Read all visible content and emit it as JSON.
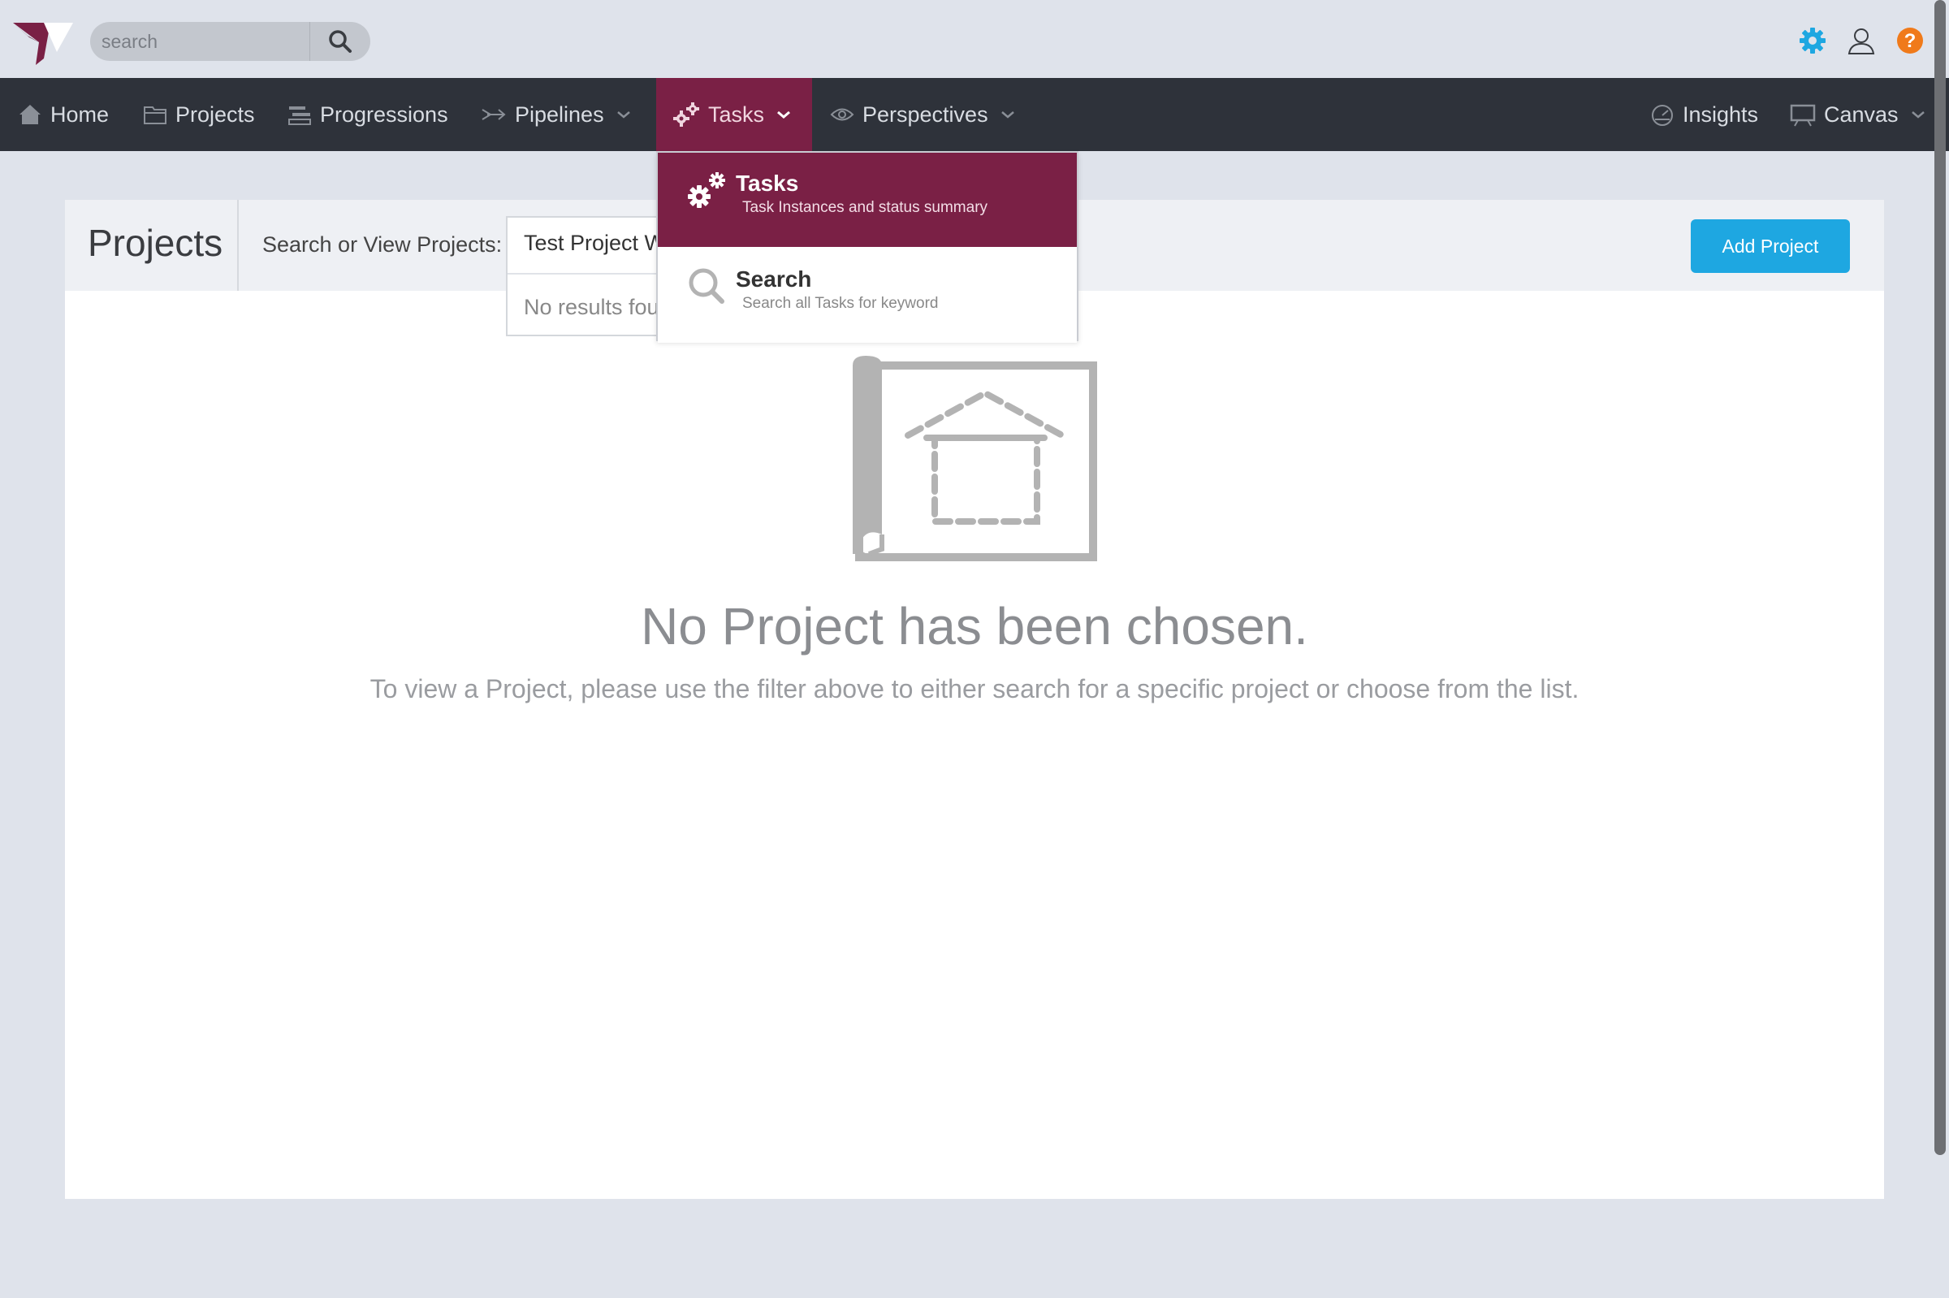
{
  "topbar": {
    "search_placeholder": "search",
    "icons": [
      "settings-gear-icon",
      "user-icon",
      "help-icon"
    ],
    "colors": {
      "gear": "#1ea7e1",
      "help": "#f07a1a"
    }
  },
  "nav": {
    "home": "Home",
    "projects": "Projects",
    "progressions": "Progressions",
    "pipelines": "Pipelines",
    "tasks": "Tasks",
    "perspectives": "Perspectives",
    "insights": "Insights",
    "canvas": "Canvas"
  },
  "tasks_menu": {
    "items": [
      {
        "title": "Tasks",
        "desc": "Task Instances and status summary"
      },
      {
        "title": "Search",
        "desc": "Search all Tasks for keyword"
      }
    ]
  },
  "panel": {
    "title": "Projects",
    "search_label": "Search or View Projects:",
    "combo_value": "Test Project W",
    "combo_empty": "No results fou",
    "add_button": "Add Project"
  },
  "empty_state": {
    "title": "No Project has been chosen.",
    "subtitle": "To view a Project, please use the filter above to either search for a specific project or choose from the list."
  },
  "colors": {
    "accent": "#7a2045",
    "nav_bg": "#2e323a",
    "button": "#1ea7e1"
  }
}
